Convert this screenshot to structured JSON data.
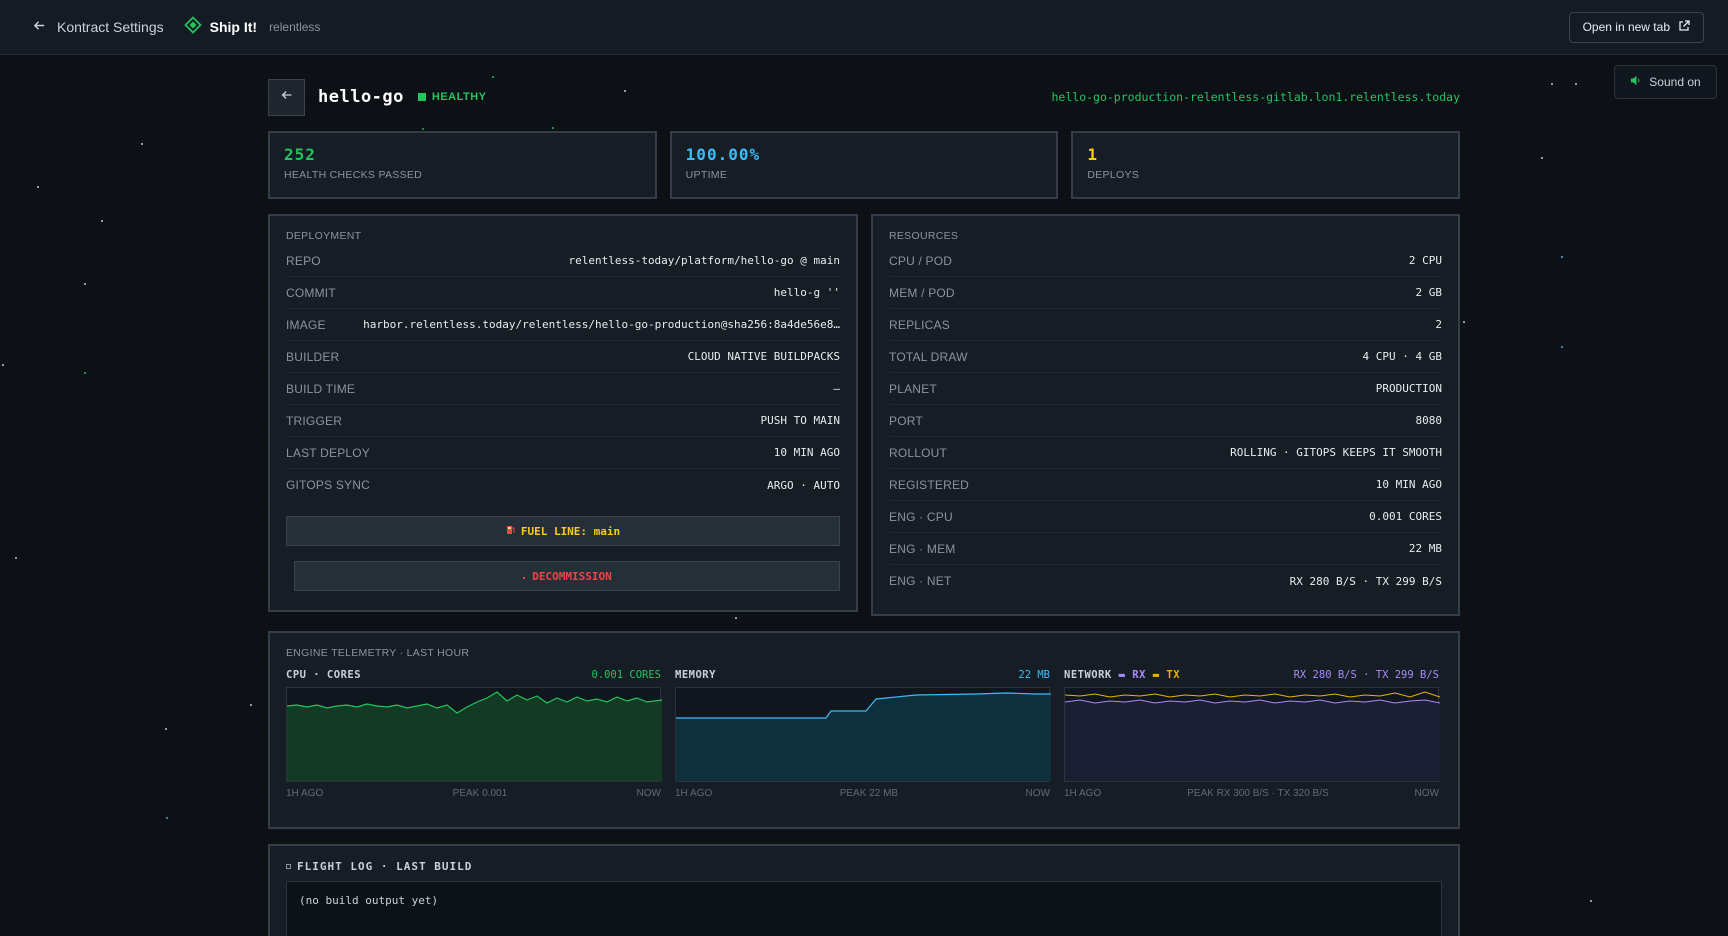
{
  "topbar": {
    "back_label": "Kontract Settings",
    "brand_name": "Ship It!",
    "brand_org": "relentless",
    "open_tab_label": "Open in new tab"
  },
  "sound_label": "Sound on",
  "app": {
    "name": "hello-go",
    "status": "HEALTHY",
    "hostname": "hello-go-production-relentless-gitlab.lon1.relentless.today"
  },
  "stats": [
    {
      "value": "252",
      "label": "HEALTH CHECKS PASSED",
      "color": "#22c55e"
    },
    {
      "value": "100.00%",
      "label": "UPTIME",
      "color": "#38bdf8"
    },
    {
      "value": "1",
      "label": "DEPLOYS",
      "color": "#facc15"
    }
  ],
  "deployment": {
    "title": "DEPLOYMENT",
    "rows": [
      {
        "k": "REPO",
        "v": "relentless-today/platform/hello-go @ main"
      },
      {
        "k": "COMMIT",
        "v": "hello-g ''"
      },
      {
        "k": "IMAGE",
        "v": "harbor.relentless.today/relentless/hello-go-production@sha256:8a4de56e8…"
      },
      {
        "k": "BUILDER",
        "v": "CLOUD NATIVE BUILDPACKS"
      },
      {
        "k": "BUILD TIME",
        "v": "—"
      },
      {
        "k": "TRIGGER",
        "v": "PUSH TO MAIN"
      },
      {
        "k": "LAST DEPLOY",
        "v": "10 MIN AGO"
      },
      {
        "k": "GITOPS SYNC",
        "v": "ARGO · AUTO"
      }
    ],
    "fuel_label": "FUEL LINE: main",
    "decommission_label": "DECOMMISSION"
  },
  "resources": {
    "title": "RESOURCES",
    "rows": [
      {
        "k": "CPU / POD",
        "v": "2 CPU"
      },
      {
        "k": "MEM / POD",
        "v": "2 GB"
      },
      {
        "k": "REPLICAS",
        "v": "2"
      },
      {
        "k": "TOTAL DRAW",
        "v": "4 CPU · 4 GB"
      },
      {
        "k": "PLANET",
        "v": "PRODUCTION"
      },
      {
        "k": "PORT",
        "v": "8080"
      },
      {
        "k": "ROLLOUT",
        "v": "ROLLING · GITOPS KEEPS IT SMOOTH"
      },
      {
        "k": "REGISTERED",
        "v": "10 MIN AGO"
      },
      {
        "k": "ENG · CPU",
        "v": "0.001 CORES"
      },
      {
        "k": "ENG · MEM",
        "v": "22 MB"
      },
      {
        "k": "ENG · NET",
        "v": "RX 280 B/S · TX 299 B/S"
      }
    ]
  },
  "telemetry": {
    "title": "ENGINE TELEMETRY · LAST HOUR",
    "charts": [
      {
        "name": "CPU · CORES",
        "current": "0.001 CORES",
        "start": "1H AGO",
        "peak": "PEAK 0.001",
        "end": "NOW",
        "color": "#22c55e"
      },
      {
        "name": "MEMORY",
        "current": "22 MB",
        "start": "1H AGO",
        "peak": "PEAK 22 MB",
        "end": "NOW",
        "color": "#38bdf8"
      },
      {
        "name": "NETWORK",
        "legend_rx": "RX",
        "legend_tx": "TX",
        "current": "RX 280 B/S · TX 299 B/S",
        "start": "1H AGO",
        "peak": "PEAK RX 300 B/S · TX 320 B/S",
        "end": "NOW",
        "color_rx": "#a78bfa",
        "color_tx": "#eab308"
      }
    ]
  },
  "flight_log": {
    "title": "FLIGHT LOG · LAST BUILD",
    "content": "(no build output yet)"
  }
}
